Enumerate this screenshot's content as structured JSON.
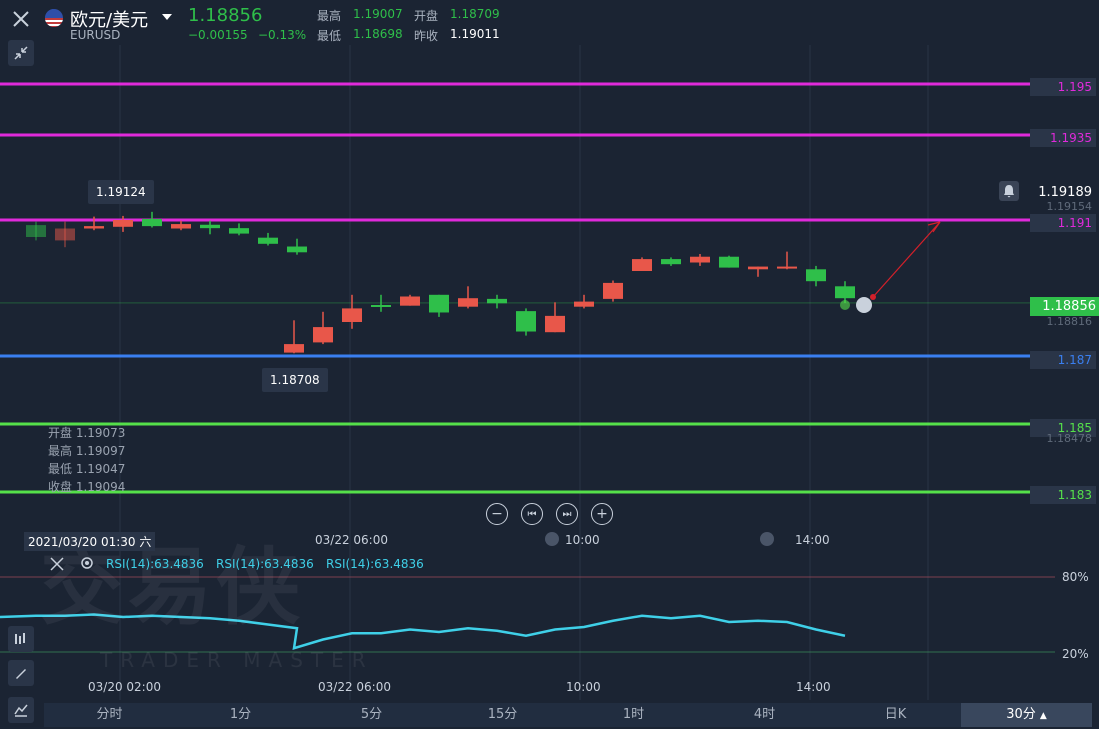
{
  "header": {
    "symbol": "欧元/美元",
    "code": "EURUSD",
    "price": "1.18856",
    "change": "−0.00155",
    "change_pct": "−0.13%",
    "high_label": "最高",
    "high": "1.19007",
    "open_label": "开盘",
    "open": "1.18709",
    "low_label": "最低",
    "low": "1.18698",
    "prev_close_label": "昨收",
    "prev_close": "1.19011"
  },
  "price_levels": [
    {
      "label": "1.195",
      "value": 1.195,
      "color": "#e02adb"
    },
    {
      "label": "1.1935",
      "value": 1.1935,
      "color": "#e02adb"
    },
    {
      "label": "1.191",
      "value": 1.191,
      "color": "#e02adb"
    },
    {
      "label": "1.187",
      "value": 1.187,
      "color": "#3a7ff0"
    },
    {
      "label": "1.185",
      "value": 1.185,
      "color": "#55e04a"
    },
    {
      "label": "1.183",
      "value": 1.183,
      "color": "#55e04a"
    }
  ],
  "axis_extra": {
    "alert_price": "1.19189",
    "faded_1": "1.19154",
    "current_price": "1.18856",
    "faded_2": "1.18816",
    "faded_3": "1.18478"
  },
  "callouts": {
    "high": "1.19124",
    "low": "1.18708"
  },
  "crosshair_ohlc": {
    "open": "开盘 1.19073",
    "high": "最高 1.19097",
    "low": "最低 1.19047",
    "close": "收盘 1.19094"
  },
  "crosshair_time": "2021/03/20 01:30 六",
  "time_axis_top": [
    "03/22 06:00",
    "10:00",
    "14:00"
  ],
  "time_axis_bottom": [
    "03/20 02:00",
    "03/22 06:00",
    "10:00",
    "14:00"
  ],
  "rsi": {
    "labels": [
      "RSI(14):63.4836",
      "RSI(14):63.4836",
      "RSI(14):63.4836"
    ],
    "level_high": "80%",
    "level_low": "20%"
  },
  "tabs": [
    "分时",
    "1分",
    "5分",
    "15分",
    "1时",
    "4时",
    "日K",
    "30分"
  ],
  "active_tab": "30分",
  "watermark": {
    "text": "交易侠",
    "sub": "TRADER MASTER"
  },
  "colors": {
    "up": "#e8574a",
    "down": "#2fbf4a",
    "bg": "#1b2433",
    "rsi": "#3fd0e8"
  },
  "chart_data": {
    "type": "candlestick",
    "series": [
      {
        "name": "EURUSD",
        "candles": [
          {
            "o": 1.19085,
            "c": 1.1905,
            "h": 1.19095,
            "l": 1.1904
          },
          {
            "o": 1.1904,
            "c": 1.19075,
            "h": 1.19095,
            "l": 1.1902
          },
          {
            "o": 1.19075,
            "c": 1.19082,
            "h": 1.1911,
            "l": 1.1907
          },
          {
            "o": 1.1908,
            "c": 1.191,
            "h": 1.19112,
            "l": 1.19065
          },
          {
            "o": 1.19103,
            "c": 1.19082,
            "h": 1.19124,
            "l": 1.19078
          },
          {
            "o": 1.19075,
            "c": 1.19088,
            "h": 1.19098,
            "l": 1.1907
          },
          {
            "o": 1.19086,
            "c": 1.19076,
            "h": 1.19098,
            "l": 1.19058
          },
          {
            "o": 1.19076,
            "c": 1.1906,
            "h": 1.1909,
            "l": 1.19055
          },
          {
            "o": 1.19048,
            "c": 1.1903,
            "h": 1.19062,
            "l": 1.19025
          },
          {
            "o": 1.19022,
            "c": 1.19005,
            "h": 1.19045,
            "l": 1.18998
          },
          {
            "o": 1.1871,
            "c": 1.18735,
            "h": 1.18805,
            "l": 1.18708
          },
          {
            "o": 1.1874,
            "c": 1.18785,
            "h": 1.1883,
            "l": 1.18735
          },
          {
            "o": 1.188,
            "c": 1.1884,
            "h": 1.1888,
            "l": 1.1878
          },
          {
            "o": 1.1885,
            "c": 1.18845,
            "h": 1.1888,
            "l": 1.1883
          },
          {
            "o": 1.18848,
            "c": 1.18875,
            "h": 1.1888,
            "l": 1.18848
          },
          {
            "o": 1.1888,
            "c": 1.18828,
            "h": 1.1888,
            "l": 1.18815
          },
          {
            "o": 1.18845,
            "c": 1.1887,
            "h": 1.18905,
            "l": 1.1884
          },
          {
            "o": 1.18868,
            "c": 1.18855,
            "h": 1.1888,
            "l": 1.1884
          },
          {
            "o": 1.18832,
            "c": 1.18772,
            "h": 1.1884,
            "l": 1.1876
          },
          {
            "o": 1.1877,
            "c": 1.18818,
            "h": 1.18858,
            "l": 1.1877
          },
          {
            "o": 1.18845,
            "c": 1.1886,
            "h": 1.1888,
            "l": 1.1884
          },
          {
            "o": 1.18868,
            "c": 1.18915,
            "h": 1.18922,
            "l": 1.1886
          },
          {
            "o": 1.1895,
            "c": 1.18985,
            "h": 1.1899,
            "l": 1.1895
          },
          {
            "o": 1.18985,
            "c": 1.1897,
            "h": 1.1899,
            "l": 1.18965
          },
          {
            "o": 1.18975,
            "c": 1.18992,
            "h": 1.19,
            "l": 1.18965
          },
          {
            "o": 1.18992,
            "c": 1.1896,
            "h": 1.18995,
            "l": 1.1896
          },
          {
            "o": 1.18955,
            "c": 1.18963,
            "h": 1.18963,
            "l": 1.18933
          },
          {
            "o": 1.18963,
            "c": 1.18963,
            "h": 1.19007,
            "l": 1.18955
          },
          {
            "o": 1.18955,
            "c": 1.1892,
            "h": 1.18965,
            "l": 1.18905
          },
          {
            "o": 1.18905,
            "c": 1.1887,
            "h": 1.1892,
            "l": 1.18856
          }
        ]
      }
    ],
    "rsi_values": [
      48,
      49,
      49,
      50,
      48,
      49,
      48,
      47,
      45,
      42,
      39,
      23,
      30,
      35,
      35,
      38,
      36,
      39,
      37,
      33,
      38,
      40,
      45,
      49,
      47,
      49,
      44,
      45,
      44,
      38,
      33
    ],
    "y_axis_ticks": [
      1.195,
      1.1935,
      1.191,
      1.187,
      1.185,
      1.183
    ],
    "rsi_levels": [
      80,
      20
    ],
    "grid": true
  }
}
